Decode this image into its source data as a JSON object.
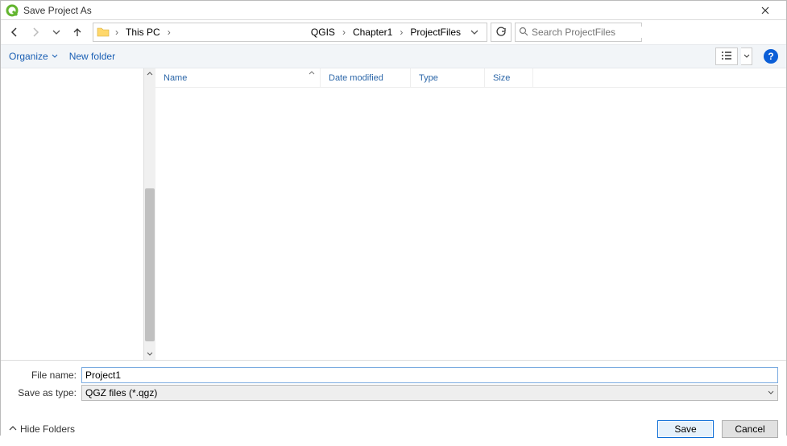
{
  "window": {
    "title": "Save Project As"
  },
  "nav": {
    "path_root": "This PC"
  },
  "breadcrumbs": [
    "QGIS",
    "Chapter1",
    "ProjectFiles"
  ],
  "search": {
    "placeholder": "Search ProjectFiles"
  },
  "toolbar": {
    "organize": "Organize",
    "new_folder": "New folder"
  },
  "columns": {
    "name": "Name",
    "date": "Date modified",
    "type": "Type",
    "size": "Size"
  },
  "fields": {
    "file_name_label": "File name:",
    "file_name_value": "Project1",
    "save_type_label": "Save as type:",
    "save_type_value": "QGZ files (*.qgz)"
  },
  "actions": {
    "hide_folders": "Hide Folders",
    "save": "Save",
    "cancel": "Cancel"
  }
}
